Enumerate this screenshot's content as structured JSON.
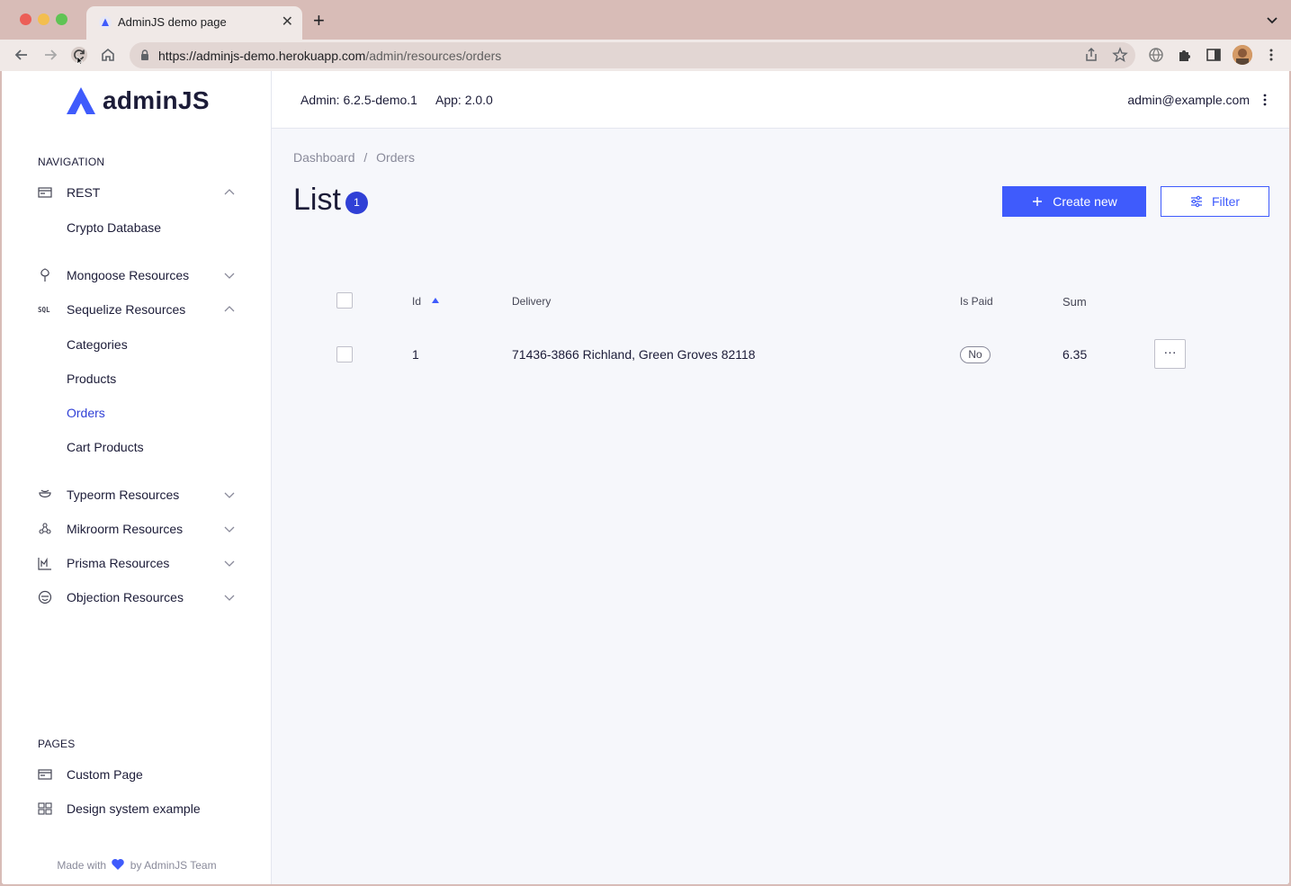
{
  "browser": {
    "tab_title": "AdminJS demo page",
    "url_host": "https://adminjs-demo.herokuapp.com",
    "url_path": "/admin/resources/orders",
    "icons": [
      "back-icon",
      "forward-icon",
      "reload-icon",
      "home-icon",
      "lock-icon",
      "share-icon",
      "star-icon",
      "translate-icon",
      "extensions-icon",
      "sidebar-icon",
      "profile-avatar",
      "menu-icon"
    ]
  },
  "logo": {
    "text": "adminJS"
  },
  "sidebar": {
    "navigation_title": "NAVIGATION",
    "groups": [
      {
        "label": "REST",
        "icon": "rest-icon",
        "expanded": true,
        "children": [
          "Crypto Database"
        ]
      },
      {
        "label": "Mongoose Resources",
        "icon": "mongoose-icon",
        "expanded": false,
        "children": []
      },
      {
        "label": "Sequelize Resources",
        "icon": "sql-icon",
        "expanded": true,
        "children": [
          "Categories",
          "Products",
          "Orders",
          "Cart Products"
        ]
      },
      {
        "label": "Typeorm Resources",
        "icon": "typeorm-icon",
        "expanded": false,
        "children": []
      },
      {
        "label": "Mikroorm Resources",
        "icon": "mikroorm-icon",
        "expanded": false,
        "children": []
      },
      {
        "label": "Prisma Resources",
        "icon": "prisma-icon",
        "expanded": false,
        "children": []
      },
      {
        "label": "Objection Resources",
        "icon": "objection-icon",
        "expanded": false,
        "children": []
      }
    ],
    "active_item": "Orders",
    "pages_title": "PAGES",
    "pages": [
      "Custom Page",
      "Design system example"
    ],
    "footer": {
      "prefix": "Made with",
      "suffix": "by AdminJS Team"
    }
  },
  "topbar": {
    "admin_version": "Admin: 6.2.5-demo.1",
    "app_version": "App: 2.0.0",
    "user_email": "admin@example.com"
  },
  "breadcrumb": [
    "Dashboard",
    "/",
    "Orders"
  ],
  "list": {
    "title": "List",
    "count": "1",
    "create_label": "Create new",
    "filter_label": "Filter",
    "columns": [
      "Id",
      "Delivery",
      "Is Paid",
      "Sum"
    ],
    "sort_column": "Id",
    "rows": [
      {
        "id": "1",
        "delivery": "71436-3866 Richland, Green Groves 82118",
        "is_paid": "No",
        "sum": "6.35",
        "actions": "···"
      }
    ]
  },
  "colors": {
    "primary": "#3f5bfc",
    "active_nav": "#3040d6",
    "heart": "#3f5bfc"
  }
}
